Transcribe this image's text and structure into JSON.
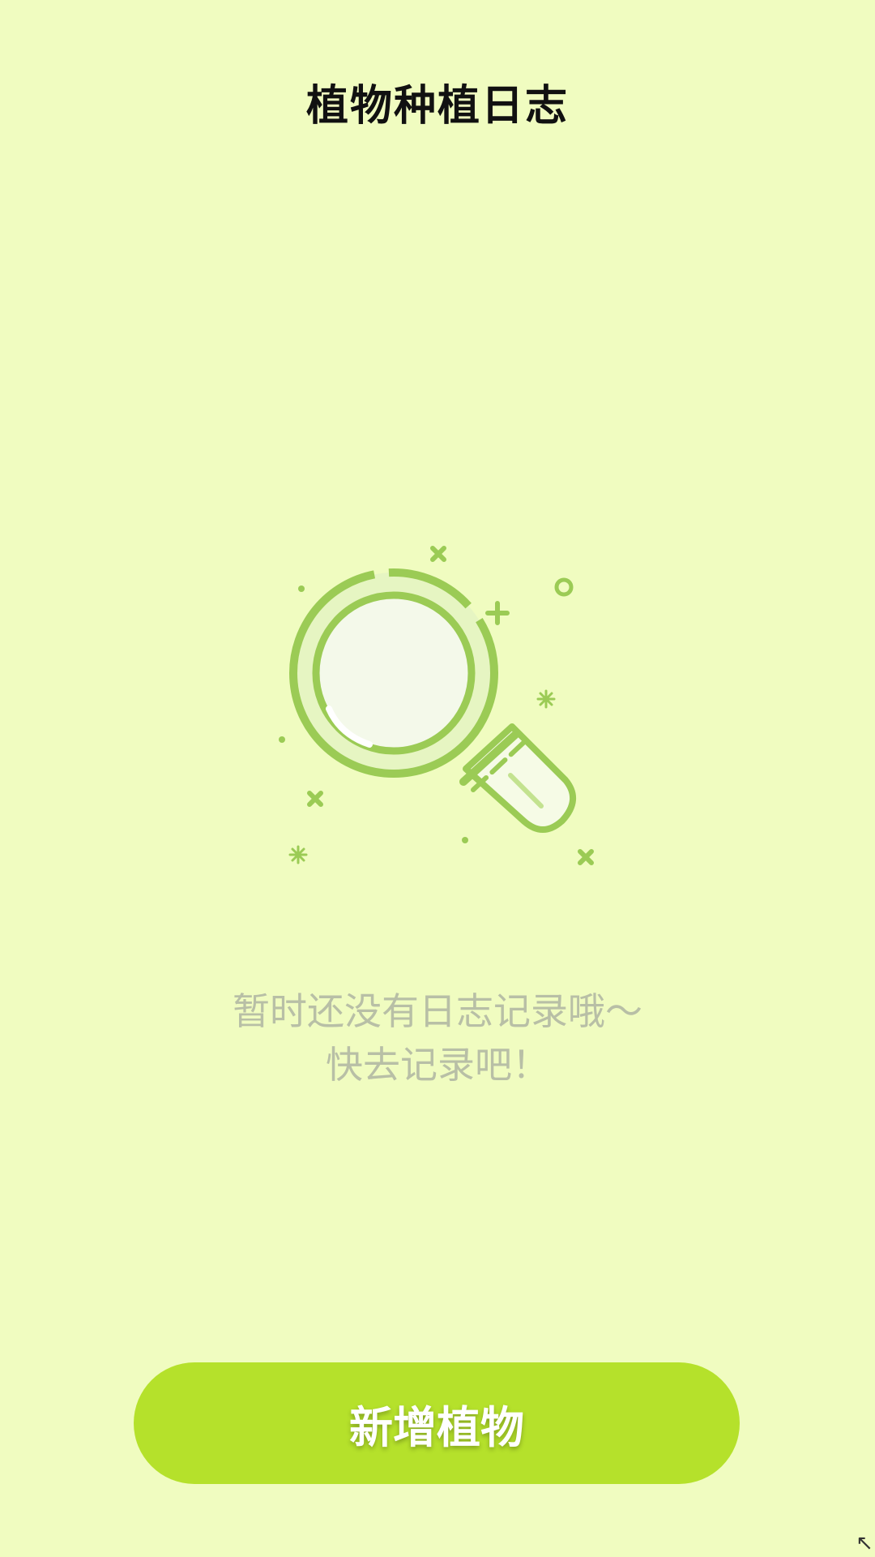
{
  "header": {
    "title": "植物种植日志"
  },
  "empty_state": {
    "icon": "magnifier-icon",
    "line1": "暂时还没有日志记录哦～",
    "line2": "快去记录吧！"
  },
  "footer": {
    "add_plant_label": "新增植物"
  },
  "colors": {
    "background": "#f0fcc0",
    "accent_green": "#b5e12b",
    "icon_green": "#9bcb55",
    "muted_text": "#b8bfa6"
  }
}
